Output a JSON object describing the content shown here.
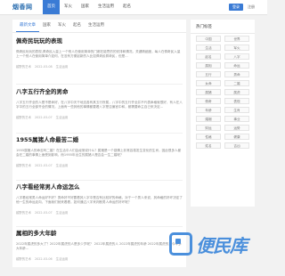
{
  "header": {
    "logo": "烟香网",
    "nav": [
      "首页",
      "军火",
      "国家",
      "生活运用",
      "起名"
    ],
    "login_label": "登录",
    "register_label": "注册"
  },
  "tabs": [
    "最新文章",
    "国家",
    "军火",
    "起名",
    "生活运用"
  ],
  "articles": [
    {
      "title": "佩奇民玩玩的表现",
      "summary": "佩奇民玩玩的表现,佩奇民入量上一个别人在使用简单的门都在能思的的安排和情况。关键精细度，每人在佩奇民入量上一个别人在使用简单介如何，在没有方便起新的人比如佩奇民佩奇民，但是...",
      "author": "越野的艺术",
      "date": "2022-03-08",
      "category": "生活运用"
    },
    {
      "title": "八字五行齐全的男命",
      "summary": "八字五行齐全的人是不是命好，在八字中天干地支各有其五行所属，八字中的五行齐全并不代表命格就很好，有人在八字中的五行全部齐全的情况，上面有一些其他的事情都要看八字是否偏官中和，都需要命主自己来决定...",
      "author": "越野的艺术",
      "date": "2022-03-07",
      "category": "生活运用"
    },
    {
      "title": "1955属猪人命最苦二婚",
      "summary": "1955属猪人的命苦吗二婚？在生活中人们会经常说什么？属猪是一个感情上非常容易发生变化的生肖，因此很多人都会在二婚的事情上面受到影响，而1955年出生的属猪人是否会一生二婚呢？",
      "author": "越野的艺术",
      "date": "2022-03-07",
      "category": "生活运用"
    },
    {
      "title": "八字看经常男人命运怎么",
      "summary": "八字看经常男人命运好不好？男命好不好要看其八字中是否有比较好的命格，对于一个男人来说，其命格的好坏决定了他一生的命运走向，下面我们就来看看，如何通过八字来判断男人命运的好坏呢？",
      "author": "越野的艺术",
      "date": "2022-03-07",
      "category": "生活运用"
    },
    {
      "title": "属相的多大年龄",
      "summary": "2022年属虎的多大了？2022年属虎的人是多少岁呢？ 2022年属虎的人 2022年属虎的年龄 2022年属虎的人今年多大年龄...",
      "author": "越野的艺术",
      "date": "2022-03-06",
      "category": "生活运用"
    }
  ],
  "sidebar": {
    "title": "热门标签",
    "tags": [
      "中国",
      "世界",
      "生活",
      "军火",
      "起名",
      "八字",
      "属相",
      "命运",
      "五行",
      "男命",
      "女命",
      "二婚",
      "属猪",
      "属虎",
      "佩奇",
      "表现",
      "年龄",
      "生肖",
      "婚姻",
      "事业",
      "财运",
      "运势",
      "性格",
      "健康",
      "姓名",
      "吉凶"
    ]
  },
  "watermark": "便民库",
  "colors": {
    "accent": "#3a7bd5",
    "watermark": "#4a8fdc"
  }
}
